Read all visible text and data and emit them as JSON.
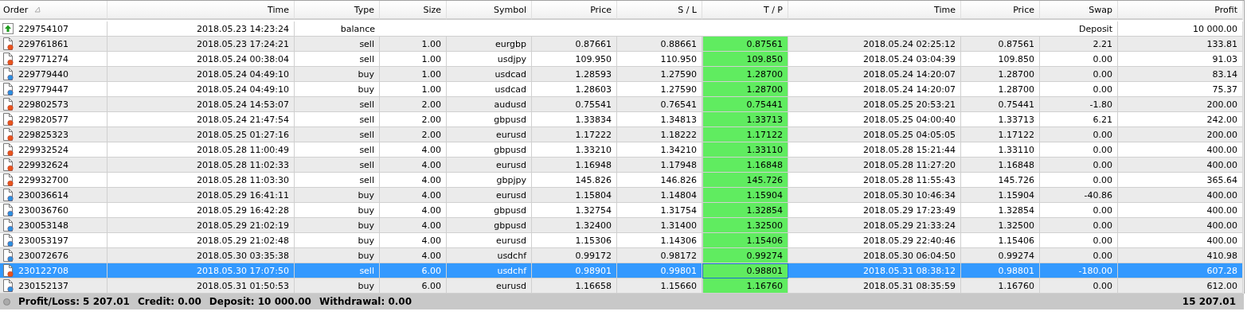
{
  "columns": [
    {
      "label": "Order",
      "sorted": true
    },
    {
      "label": "Time",
      "sorted": false
    },
    {
      "label": "Type",
      "sorted": false
    },
    {
      "label": "Size",
      "sorted": false
    },
    {
      "label": "Symbol",
      "sorted": false
    },
    {
      "label": "Price",
      "sorted": false
    },
    {
      "label": "S / L",
      "sorted": false
    },
    {
      "label": "T / P",
      "sorted": false
    },
    {
      "label": "Time",
      "sorted": false
    },
    {
      "label": "Price",
      "sorted": false
    },
    {
      "label": "Swap",
      "sorted": false
    },
    {
      "label": "Profit",
      "sorted": false
    }
  ],
  "rows": [
    {
      "kind": "balance",
      "selected": false,
      "order": "229754107",
      "time": "2018.05.23 14:23:24",
      "type": "balance",
      "comment": "Deposit",
      "profit": "10 000.00"
    },
    {
      "kind": "sell",
      "selected": false,
      "order": "229761861",
      "time": "2018.05.23 17:24:21",
      "type": "sell",
      "size": "1.00",
      "symbol": "eurgbp",
      "price": "0.87661",
      "sl": "0.88661",
      "tp": "0.87561",
      "close_time": "2018.05.24 02:25:12",
      "close_price": "0.87561",
      "swap": "2.21",
      "profit": "133.81"
    },
    {
      "kind": "sell",
      "selected": false,
      "order": "229771274",
      "time": "2018.05.24 00:38:04",
      "type": "sell",
      "size": "1.00",
      "symbol": "usdjpy",
      "price": "109.950",
      "sl": "110.950",
      "tp": "109.850",
      "close_time": "2018.05.24 03:04:39",
      "close_price": "109.850",
      "swap": "0.00",
      "profit": "91.03"
    },
    {
      "kind": "buy",
      "selected": false,
      "order": "229779440",
      "time": "2018.05.24 04:49:10",
      "type": "buy",
      "size": "1.00",
      "symbol": "usdcad",
      "price": "1.28593",
      "sl": "1.27590",
      "tp": "1.28700",
      "close_time": "2018.05.24 14:20:07",
      "close_price": "1.28700",
      "swap": "0.00",
      "profit": "83.14"
    },
    {
      "kind": "buy",
      "selected": false,
      "order": "229779447",
      "time": "2018.05.24 04:49:10",
      "type": "buy",
      "size": "1.00",
      "symbol": "usdcad",
      "price": "1.28603",
      "sl": "1.27590",
      "tp": "1.28700",
      "close_time": "2018.05.24 14:20:07",
      "close_price": "1.28700",
      "swap": "0.00",
      "profit": "75.37"
    },
    {
      "kind": "sell",
      "selected": false,
      "order": "229802573",
      "time": "2018.05.24 14:53:07",
      "type": "sell",
      "size": "2.00",
      "symbol": "audusd",
      "price": "0.75541",
      "sl": "0.76541",
      "tp": "0.75441",
      "close_time": "2018.05.25 20:53:21",
      "close_price": "0.75441",
      "swap": "-1.80",
      "profit": "200.00"
    },
    {
      "kind": "sell",
      "selected": false,
      "order": "229820577",
      "time": "2018.05.24 21:47:54",
      "type": "sell",
      "size": "2.00",
      "symbol": "gbpusd",
      "price": "1.33834",
      "sl": "1.34813",
      "tp": "1.33713",
      "close_time": "2018.05.25 04:00:40",
      "close_price": "1.33713",
      "swap": "6.21",
      "profit": "242.00"
    },
    {
      "kind": "sell",
      "selected": false,
      "order": "229825323",
      "time": "2018.05.25 01:27:16",
      "type": "sell",
      "size": "2.00",
      "symbol": "eurusd",
      "price": "1.17222",
      "sl": "1.18222",
      "tp": "1.17122",
      "close_time": "2018.05.25 04:05:05",
      "close_price": "1.17122",
      "swap": "0.00",
      "profit": "200.00"
    },
    {
      "kind": "sell",
      "selected": false,
      "order": "229932524",
      "time": "2018.05.28 11:00:49",
      "type": "sell",
      "size": "4.00",
      "symbol": "gbpusd",
      "price": "1.33210",
      "sl": "1.34210",
      "tp": "1.33110",
      "close_time": "2018.05.28 15:21:44",
      "close_price": "1.33110",
      "swap": "0.00",
      "profit": "400.00"
    },
    {
      "kind": "sell",
      "selected": false,
      "order": "229932624",
      "time": "2018.05.28 11:02:33",
      "type": "sell",
      "size": "4.00",
      "symbol": "eurusd",
      "price": "1.16948",
      "sl": "1.17948",
      "tp": "1.16848",
      "close_time": "2018.05.28 11:27:20",
      "close_price": "1.16848",
      "swap": "0.00",
      "profit": "400.00"
    },
    {
      "kind": "sell",
      "selected": false,
      "order": "229932700",
      "time": "2018.05.28 11:03:30",
      "type": "sell",
      "size": "4.00",
      "symbol": "gbpjpy",
      "price": "145.826",
      "sl": "146.826",
      "tp": "145.726",
      "close_time": "2018.05.28 11:55:43",
      "close_price": "145.726",
      "swap": "0.00",
      "profit": "365.64"
    },
    {
      "kind": "buy",
      "selected": false,
      "order": "230036614",
      "time": "2018.05.29 16:41:11",
      "type": "buy",
      "size": "4.00",
      "symbol": "eurusd",
      "price": "1.15804",
      "sl": "1.14804",
      "tp": "1.15904",
      "close_time": "2018.05.30 10:46:34",
      "close_price": "1.15904",
      "swap": "-40.86",
      "profit": "400.00"
    },
    {
      "kind": "buy",
      "selected": false,
      "order": "230036760",
      "time": "2018.05.29 16:42:28",
      "type": "buy",
      "size": "4.00",
      "symbol": "gbpusd",
      "price": "1.32754",
      "sl": "1.31754",
      "tp": "1.32854",
      "close_time": "2018.05.29 17:23:49",
      "close_price": "1.32854",
      "swap": "0.00",
      "profit": "400.00"
    },
    {
      "kind": "buy",
      "selected": false,
      "order": "230053148",
      "time": "2018.05.29 21:02:19",
      "type": "buy",
      "size": "4.00",
      "symbol": "gbpusd",
      "price": "1.32400",
      "sl": "1.31400",
      "tp": "1.32500",
      "close_time": "2018.05.29 21:33:24",
      "close_price": "1.32500",
      "swap": "0.00",
      "profit": "400.00"
    },
    {
      "kind": "buy",
      "selected": false,
      "order": "230053197",
      "time": "2018.05.29 21:02:48",
      "type": "buy",
      "size": "4.00",
      "symbol": "eurusd",
      "price": "1.15306",
      "sl": "1.14306",
      "tp": "1.15406",
      "close_time": "2018.05.29 22:40:46",
      "close_price": "1.15406",
      "swap": "0.00",
      "profit": "400.00"
    },
    {
      "kind": "buy",
      "selected": false,
      "order": "230072676",
      "time": "2018.05.30 03:35:38",
      "type": "buy",
      "size": "4.00",
      "symbol": "usdchf",
      "price": "0.99172",
      "sl": "0.98172",
      "tp": "0.99274",
      "close_time": "2018.05.30 06:04:50",
      "close_price": "0.99274",
      "swap": "0.00",
      "profit": "410.98"
    },
    {
      "kind": "sell",
      "selected": true,
      "order": "230122708",
      "time": "2018.05.30 17:07:50",
      "type": "sell",
      "size": "6.00",
      "symbol": "usdchf",
      "price": "0.98901",
      "sl": "0.99801",
      "tp": "0.98801",
      "close_time": "2018.05.31 08:38:12",
      "close_price": "0.98801",
      "swap": "-180.00",
      "profit": "607.28"
    },
    {
      "kind": "buy",
      "selected": false,
      "order": "230152137",
      "time": "2018.05.31 01:50:53",
      "type": "buy",
      "size": "6.00",
      "symbol": "eurusd",
      "price": "1.16658",
      "sl": "1.15660",
      "tp": "1.16760",
      "close_time": "2018.05.31 08:35:59",
      "close_price": "1.16760",
      "swap": "0.00",
      "profit": "612.00"
    }
  ],
  "status_bar": {
    "items": [
      "Profit/Loss: 5 207.01",
      "Credit: 0.00",
      "Deposit: 10 000.00",
      "Withdrawal: 0.00"
    ],
    "total": "15 207.01"
  }
}
